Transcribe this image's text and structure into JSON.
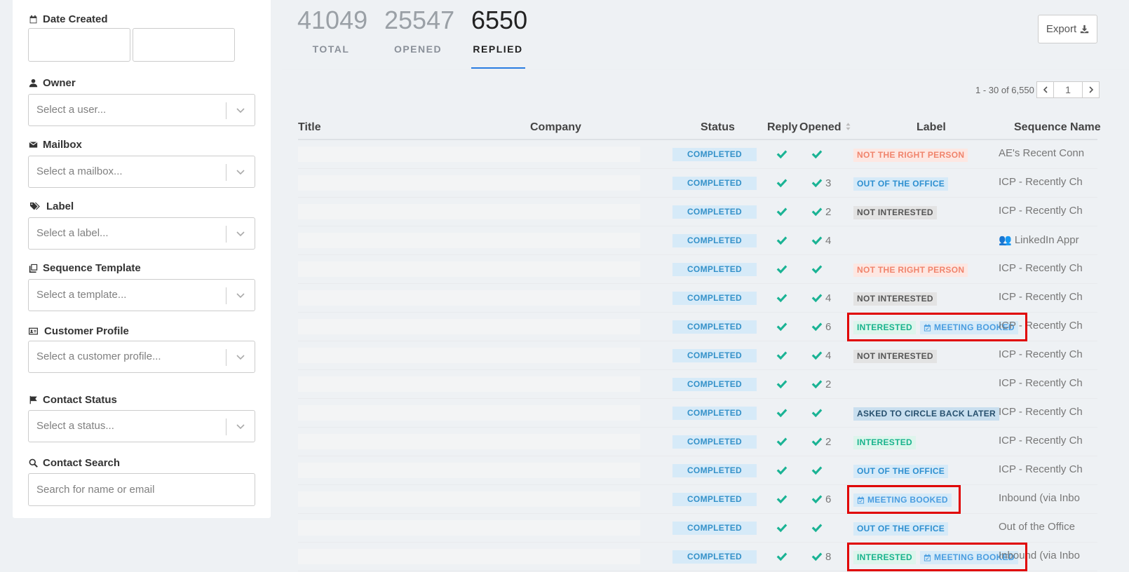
{
  "filters": {
    "date_created": {
      "label": "Date Created"
    },
    "owner": {
      "label": "Owner",
      "placeholder": "Select a user..."
    },
    "mailbox": {
      "label": "Mailbox",
      "placeholder": "Select a mailbox..."
    },
    "label": {
      "label": "Label",
      "placeholder": "Select a label..."
    },
    "sequence_template": {
      "label": "Sequence Template",
      "placeholder": "Select a template..."
    },
    "customer_profile": {
      "label": "Customer Profile",
      "placeholder": "Select a customer profile..."
    },
    "contact_status": {
      "label": "Contact Status",
      "placeholder": "Select a status..."
    },
    "contact_search": {
      "label": "Contact Search",
      "placeholder": "Search for name or email"
    }
  },
  "stats": {
    "total": {
      "value": "41049",
      "label": "TOTAL"
    },
    "opened": {
      "value": "25547",
      "label": "OPENED"
    },
    "replied": {
      "value": "6550",
      "label": "REPLIED"
    },
    "active": "replied"
  },
  "export_label": "Export",
  "pagination": {
    "range_text": "1 - 30 of 6,550",
    "page": "1"
  },
  "columns": {
    "title": "Title",
    "company": "Company",
    "status": "Status",
    "reply": "Reply",
    "opened": "Opened",
    "label": "Label",
    "sequence_name": "Sequence Name"
  },
  "rows": [
    {
      "status": "COMPLETED",
      "opened_count": "",
      "labels": [
        {
          "text": "NOT THE RIGHT PERSON",
          "style": "red"
        }
      ],
      "sequence": "AE's Recent Conn"
    },
    {
      "status": "COMPLETED",
      "opened_count": "3",
      "labels": [
        {
          "text": "OUT OF THE OFFICE",
          "style": "blue"
        }
      ],
      "sequence": "ICP - Recently Ch"
    },
    {
      "status": "COMPLETED",
      "opened_count": "2",
      "labels": [
        {
          "text": "NOT INTERESTED",
          "style": "gray"
        }
      ],
      "sequence": "ICP - Recently Ch"
    },
    {
      "status": "COMPLETED",
      "opened_count": "4",
      "labels": [],
      "sequence": "👥 LinkedIn Appr"
    },
    {
      "status": "COMPLETED",
      "opened_count": "",
      "labels": [
        {
          "text": "NOT THE RIGHT PERSON",
          "style": "red"
        }
      ],
      "sequence": "ICP - Recently Ch"
    },
    {
      "status": "COMPLETED",
      "opened_count": "4",
      "labels": [
        {
          "text": "NOT INTERESTED",
          "style": "gray"
        }
      ],
      "sequence": "ICP - Recently Ch"
    },
    {
      "status": "COMPLETED",
      "opened_count": "6",
      "labels": [
        {
          "text": "INTERESTED",
          "style": "green"
        },
        {
          "text": "MEETING BOOKED",
          "style": "meeting"
        }
      ],
      "sequence": "ICP - Recently Ch",
      "highlighted": true
    },
    {
      "status": "COMPLETED",
      "opened_count": "4",
      "labels": [
        {
          "text": "NOT INTERESTED",
          "style": "gray"
        }
      ],
      "sequence": "ICP - Recently Ch"
    },
    {
      "status": "COMPLETED",
      "opened_count": "2",
      "labels": [],
      "sequence": "ICP - Recently Ch"
    },
    {
      "status": "COMPLETED",
      "opened_count": "",
      "labels": [
        {
          "text": "ASKED TO CIRCLE BACK LATER",
          "style": "navy"
        }
      ],
      "sequence": "ICP - Recently Ch"
    },
    {
      "status": "COMPLETED",
      "opened_count": "2",
      "labels": [
        {
          "text": "INTERESTED",
          "style": "green"
        }
      ],
      "sequence": "ICP - Recently Ch"
    },
    {
      "status": "COMPLETED",
      "opened_count": "",
      "labels": [
        {
          "text": "OUT OF THE OFFICE",
          "style": "blue"
        }
      ],
      "sequence": "ICP - Recently Ch"
    },
    {
      "status": "COMPLETED",
      "opened_count": "6",
      "labels": [
        {
          "text": "MEETING BOOKED",
          "style": "meeting"
        }
      ],
      "sequence": "Inbound (via Inbo",
      "highlighted": true
    },
    {
      "status": "COMPLETED",
      "opened_count": "",
      "labels": [
        {
          "text": "OUT OF THE OFFICE",
          "style": "blue"
        }
      ],
      "sequence": "Out of the Office"
    },
    {
      "status": "COMPLETED",
      "opened_count": "8",
      "labels": [
        {
          "text": "INTERESTED",
          "style": "green"
        },
        {
          "text": "MEETING BOOKED",
          "style": "meeting"
        }
      ],
      "sequence": "Inbound (via Inbo",
      "highlighted": true
    }
  ],
  "colors": {
    "accent": "#2a7de1",
    "check": "#1ab394",
    "highlight": "#e00000"
  }
}
